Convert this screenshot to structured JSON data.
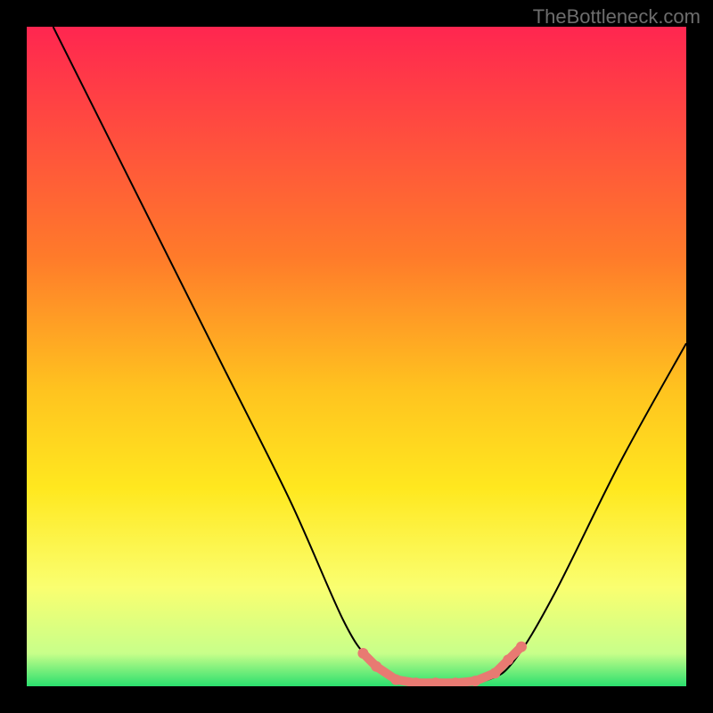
{
  "watermark": "TheBottleneck.com",
  "chart_data": {
    "type": "line",
    "title": "",
    "xlabel": "",
    "ylabel": "",
    "xlim": [
      0,
      100
    ],
    "ylim": [
      0,
      100
    ],
    "background_gradient": {
      "top": "#ff2650",
      "mid1": "#ff9a2a",
      "mid2": "#ffe81f",
      "mid3": "#faff70",
      "bottom": "#2bdf6e",
      "stops": [
        {
          "pos": 0.0,
          "color": "#ff2650"
        },
        {
          "pos": 0.35,
          "color": "#ff7b2a"
        },
        {
          "pos": 0.55,
          "color": "#ffc31f"
        },
        {
          "pos": 0.7,
          "color": "#ffe81f"
        },
        {
          "pos": 0.85,
          "color": "#faff70"
        },
        {
          "pos": 0.95,
          "color": "#c8ff8a"
        },
        {
          "pos": 1.0,
          "color": "#2bdf6e"
        }
      ]
    },
    "series": [
      {
        "name": "bottleneck-curve",
        "color": "#000000",
        "points": [
          {
            "x": 4,
            "y": 100
          },
          {
            "x": 10,
            "y": 88
          },
          {
            "x": 20,
            "y": 68
          },
          {
            "x": 30,
            "y": 48
          },
          {
            "x": 40,
            "y": 28
          },
          {
            "x": 48,
            "y": 10
          },
          {
            "x": 52,
            "y": 4
          },
          {
            "x": 56,
            "y": 1
          },
          {
            "x": 63,
            "y": 0
          },
          {
            "x": 70,
            "y": 1
          },
          {
            "x": 74,
            "y": 4
          },
          {
            "x": 80,
            "y": 14
          },
          {
            "x": 90,
            "y": 34
          },
          {
            "x": 100,
            "y": 52
          }
        ]
      }
    ],
    "markers": {
      "name": "optimal-range",
      "color": "#e87a72",
      "points": [
        {
          "x": 51,
          "y": 5
        },
        {
          "x": 53,
          "y": 3
        },
        {
          "x": 56,
          "y": 1
        },
        {
          "x": 59,
          "y": 0.5
        },
        {
          "x": 62,
          "y": 0.5
        },
        {
          "x": 65,
          "y": 0.5
        },
        {
          "x": 68,
          "y": 0.8
        },
        {
          "x": 71,
          "y": 2
        },
        {
          "x": 73,
          "y": 4
        },
        {
          "x": 75,
          "y": 6
        }
      ]
    }
  }
}
